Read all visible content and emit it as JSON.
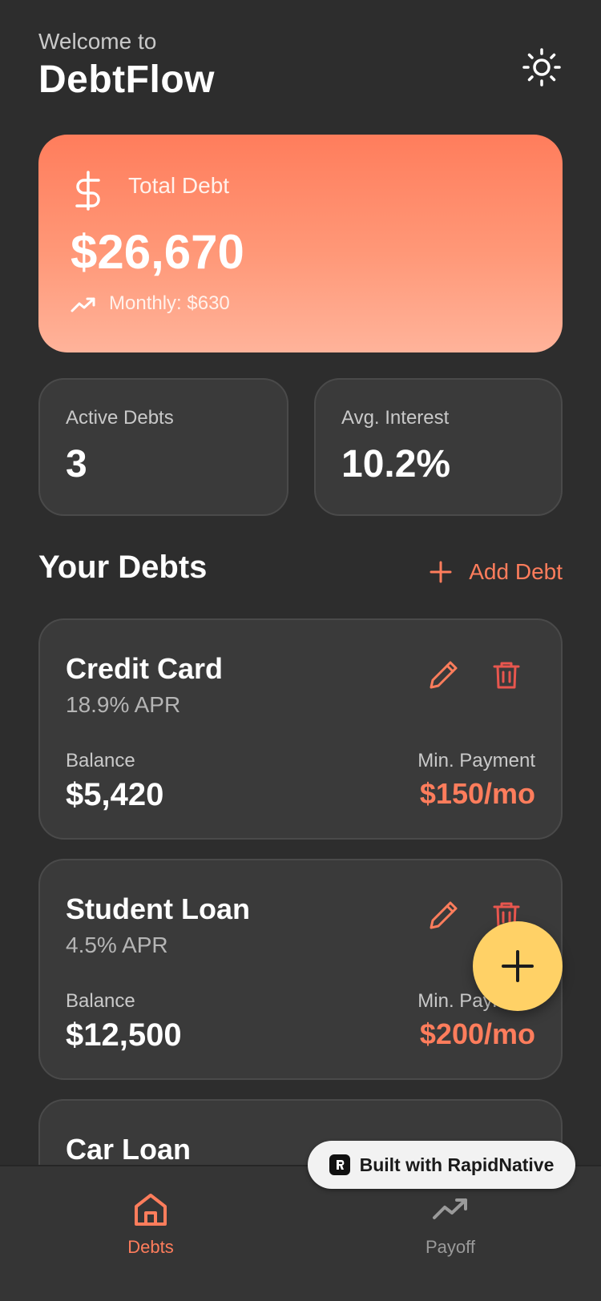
{
  "header": {
    "welcome": "Welcome to",
    "title": "DebtFlow",
    "theme_icon": "sun-icon"
  },
  "summary": {
    "label": "Total Debt",
    "value": "$26,670",
    "monthly": "Monthly: $630",
    "icon": "dollar-icon",
    "trend_icon": "trending-up-icon"
  },
  "stats": {
    "active_label": "Active Debts",
    "active_value": "3",
    "interest_label": "Avg. Interest",
    "interest_value": "10.2%"
  },
  "debts_section": {
    "title": "Your Debts",
    "add_label": "Add Debt"
  },
  "debts": [
    {
      "name": "Credit Card",
      "apr": "18.9% APR",
      "balance_label": "Balance",
      "balance": "$5,420",
      "min_label": "Min. Payment",
      "min": "$150/mo"
    },
    {
      "name": "Student Loan",
      "apr": "4.5% APR",
      "balance_label": "Balance",
      "balance": "$12,500",
      "min_label": "Min. Payment",
      "min": "$200/mo"
    },
    {
      "name": "Car Loan"
    }
  ],
  "nav": {
    "debts": "Debts",
    "payoff": "Payoff"
  },
  "badge": {
    "text": "Built with RapidNative"
  },
  "colors": {
    "background": "#2d2d2d",
    "card": "#3a3a3a",
    "accent": "#ff7d5c",
    "fab": "#ffd166",
    "delete": "#e8564e"
  }
}
